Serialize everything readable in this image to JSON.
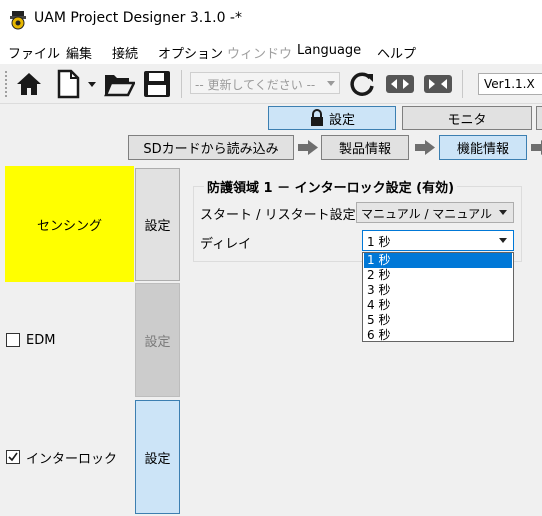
{
  "window": {
    "title": "UAM Project Designer 3.1.0 -*",
    "app_icon": "uam-app-icon"
  },
  "menu": {
    "items": [
      {
        "label": "ファイル",
        "enabled": true
      },
      {
        "label": "編集",
        "enabled": true
      },
      {
        "label": "接続",
        "enabled": true
      },
      {
        "label": "オプション",
        "enabled": true
      },
      {
        "label": "ウィンドウ",
        "enabled": false
      },
      {
        "label": "Language",
        "enabled": true
      },
      {
        "label": "ヘルプ",
        "enabled": true
      }
    ]
  },
  "toolbar": {
    "icons": [
      "home-icon",
      "new-file-icon",
      "dropdown-arrow-icon",
      "open-folder-icon",
      "save-icon",
      "refresh-icon",
      "read-transfer-icon",
      "write-transfer-icon"
    ],
    "update_combo_text": "-- 更新してください --",
    "version_text": "Ver1.1.X"
  },
  "mode_buttons": {
    "settings": "設定",
    "monitor": "モニタ",
    "lock_icon": "lock-icon"
  },
  "steps": {
    "sd_read": "SDカードから読み込み",
    "product_info": "製品情報",
    "function_info": "機能情報"
  },
  "side": {
    "sensing": {
      "label": "センシング",
      "button": "設定"
    },
    "edm": {
      "label": "EDM",
      "checked": false,
      "button": "設定",
      "button_enabled": false
    },
    "interlock": {
      "label": "インターロック",
      "checked": true,
      "button": "設定"
    }
  },
  "group": {
    "title": "防護領域 1 － インターロック設定 (有効)",
    "restart_label": "スタート / リスタート設定",
    "restart_value": "マニュアル / マニュアル",
    "delay_label": "ディレイ",
    "delay_value": "1 秒",
    "delay_options": [
      "1 秒",
      "2 秒",
      "3 秒",
      "4 秒",
      "5 秒",
      "6 秒"
    ],
    "delay_selected_index": 0
  },
  "colors": {
    "sensing_highlight": "#ffff00",
    "selected_button": "#cce4f7",
    "selected_border": "#3c7fb1",
    "dropdown_selection": "#0078d7"
  }
}
